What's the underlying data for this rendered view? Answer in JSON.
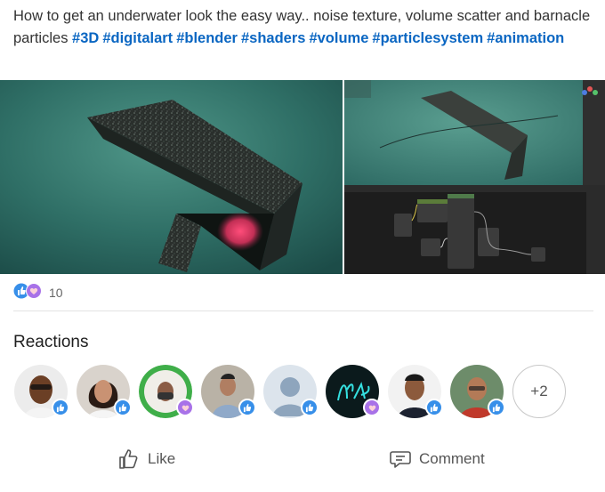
{
  "post": {
    "text": "How to get an underwater look the easy way.. noise texture, volume scatter and barnacle particles",
    "hashtags": [
      "#3D",
      "#digitalart",
      "#blender",
      "#shaders",
      "#volume",
      "#particlesystem",
      "#animation"
    ]
  },
  "media": {
    "main_alt_icon": "render-image",
    "side_alt_icon": "blender-editor-screenshot"
  },
  "reactions_summary": {
    "count": "10",
    "icons": [
      "like-icon",
      "support-icon"
    ]
  },
  "reactions": {
    "title": "Reactions",
    "more_label": "+2",
    "people": [
      {
        "badge": "like"
      },
      {
        "badge": "like"
      },
      {
        "badge": "support"
      },
      {
        "badge": "like"
      },
      {
        "badge": "like"
      },
      {
        "badge": "support"
      },
      {
        "badge": "like"
      },
      {
        "badge": "like"
      }
    ]
  },
  "actions": {
    "like_label": "Like",
    "comment_label": "Comment"
  },
  "colors": {
    "link": "#0a66c2",
    "like_badge": "#378fe9",
    "support_badge": "#a872e8"
  }
}
